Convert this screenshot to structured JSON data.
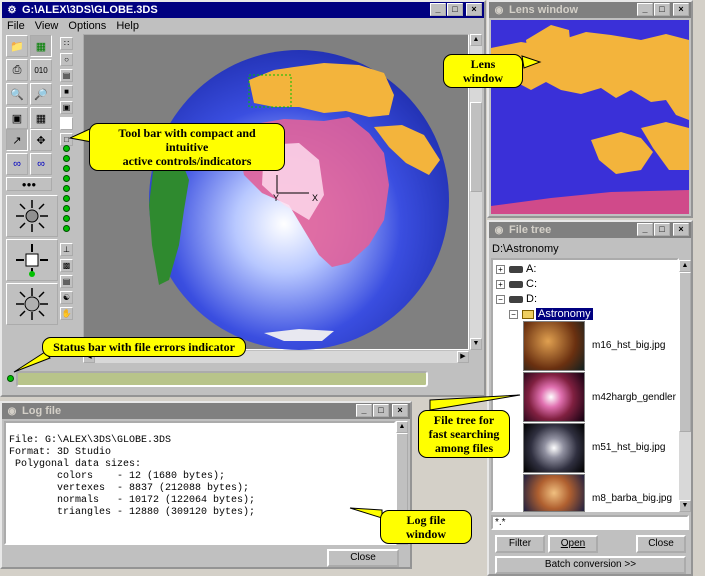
{
  "main_window": {
    "title": "G:\\ALEX\\3DS\\GLOBE.3DS",
    "menu": [
      "File",
      "View",
      "Options",
      "Help"
    ],
    "axis_labels": {
      "y": "Y",
      "x": "X"
    }
  },
  "lens_window": {
    "title": "Lens window"
  },
  "file_tree": {
    "title": "File tree",
    "path": "D:\\Astronomy",
    "drives": [
      "A:",
      "C:",
      "D:"
    ],
    "selected_folder": "Astronomy",
    "files": [
      "m16_hst_big.jpg",
      "m42hargb_gendler",
      "m51_hst_big.jpg",
      "m8_barba_big.jpg"
    ],
    "filter_value": "*.*",
    "buttons": {
      "filter": "Filter",
      "open": "Open",
      "close": "Close",
      "batch": "Batch conversion >>"
    }
  },
  "log_window": {
    "title": "Log file",
    "lines": [
      "File: G:\\ALEX\\3DS\\GLOBE.3DS",
      "Format: 3D Studio",
      "",
      " Polygonal data sizes:",
      "",
      "        colors    - 12 (1680 bytes);",
      "        vertexes  - 8837 (212088 bytes);",
      "        normals   - 10172 (122064 bytes);",
      "        triangles - 12880 (309120 bytes);"
    ],
    "close_label": "Close"
  },
  "callouts": {
    "lens": "Lens window",
    "toolbar": "Tool bar with compact and intuitive\nactive controls/indicators",
    "status": "Status bar with file errors indicator",
    "filetree": "File tree for\nfast searching\namong files",
    "log": "Log file window"
  },
  "colors": {
    "titlebar_active": "#000080",
    "titlebar_inactive": "#808080",
    "callout": "#ffff00",
    "ocean": "#2a3bd6",
    "land": "#f3b43c"
  }
}
